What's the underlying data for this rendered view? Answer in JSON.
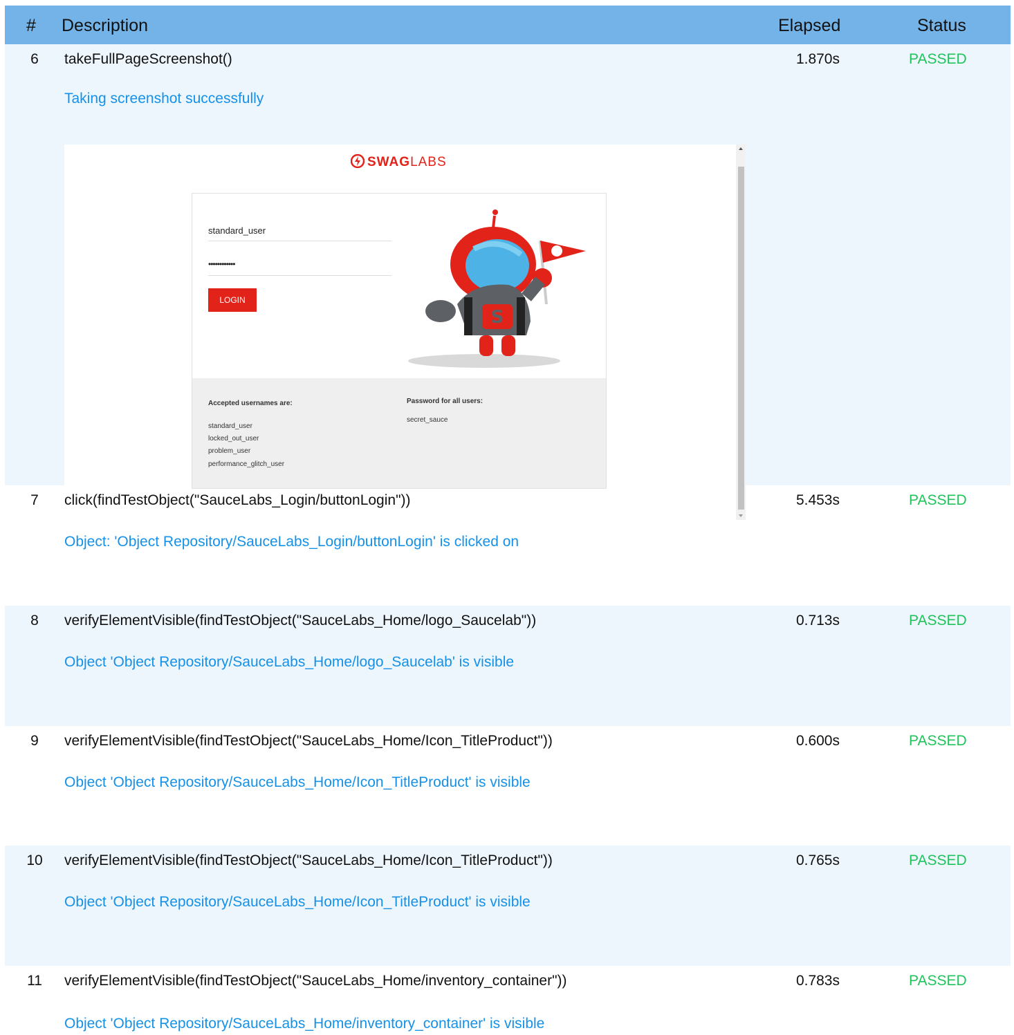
{
  "header": {
    "num": "#",
    "description": "Description",
    "elapsed": "Elapsed",
    "status": "Status"
  },
  "rows": [
    {
      "num": "6",
      "description": "takeFullPageScreenshot()",
      "elapsed": "1.870s",
      "status": "PASSED",
      "message": "Taking screenshot successfully"
    },
    {
      "num": "7",
      "description": "click(findTestObject(\"SauceLabs_Login/buttonLogin\"))",
      "elapsed": "5.453s",
      "status": "PASSED",
      "message": "Object: 'Object Repository/SauceLabs_Login/buttonLogin' is clicked on"
    },
    {
      "num": "8",
      "description": "verifyElementVisible(findTestObject(\"SauceLabs_Home/logo_Saucelab\"))",
      "elapsed": "0.713s",
      "status": "PASSED",
      "message": "Object 'Object Repository/SauceLabs_Home/logo_Saucelab' is visible"
    },
    {
      "num": "9",
      "description": "verifyElementVisible(findTestObject(\"SauceLabs_Home/Icon_TitleProduct\"))",
      "elapsed": "0.600s",
      "status": "PASSED",
      "message": "Object 'Object Repository/SauceLabs_Home/Icon_TitleProduct' is visible"
    },
    {
      "num": "10",
      "description": "verifyElementVisible(findTestObject(\"SauceLabs_Home/Icon_TitleProduct\"))",
      "elapsed": "0.765s",
      "status": "PASSED",
      "message": "Object 'Object Repository/SauceLabs_Home/Icon_TitleProduct' is visible"
    },
    {
      "num": "11",
      "description": "verifyElementVisible(findTestObject(\"SauceLabs_Home/inventory_container\"))",
      "elapsed": "0.783s",
      "status": "PASSED",
      "message": "Object 'Object Repository/SauceLabs_Home/inventory_container' is visible"
    }
  ],
  "screenshot": {
    "logo_bold": "SWAG",
    "logo_light": "LABS",
    "username_value": "standard_user",
    "password_value": "••••••••••••",
    "login_label": "LOGIN",
    "usernames_heading": "Accepted usernames are:",
    "usernames": [
      "standard_user",
      "locked_out_user",
      "problem_user",
      "performance_glitch_user"
    ],
    "password_heading": "Password for all users:",
    "password_text": "secret_sauce"
  },
  "colors": {
    "header_bg": "#74b3e8",
    "row_alt_bg": "#edf5fd",
    "passed": "#1ec45a",
    "message": "#1591e8",
    "brand_red": "#e2231a"
  }
}
